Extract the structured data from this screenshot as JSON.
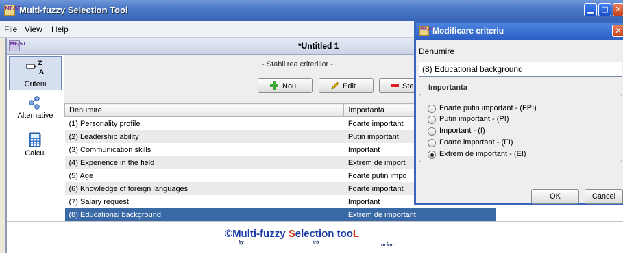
{
  "app": {
    "title": "Multi-fuzzy Selection Tool",
    "icon": "MF/ST"
  },
  "menu": [
    "File",
    "View",
    "Help"
  ],
  "document": {
    "title": "*Untitled 1"
  },
  "sidebar": [
    {
      "label": "Criterii",
      "icon": "criteria-icon"
    },
    {
      "label": "Alternative",
      "icon": "alternatives-icon"
    },
    {
      "label": "Calcul",
      "icon": "calculator-icon"
    }
  ],
  "criteria": {
    "heading": "- Stabilirea criteriilor -",
    "buttons": {
      "new": "Nou",
      "edit": "Edit",
      "delete": "Ster"
    },
    "columns": [
      "Denumire",
      "Importanta"
    ],
    "rows": [
      {
        "name": "(1) Personality profile",
        "importance": "Foarte important"
      },
      {
        "name": "(2) Leadership ability",
        "importance": "Putin important"
      },
      {
        "name": "(3) Communication skills",
        "importance": "Important"
      },
      {
        "name": "(4) Experience in the field",
        "importance": "Extrem de import"
      },
      {
        "name": "(5) Age",
        "importance": "Foarte putin impo"
      },
      {
        "name": "(6) Knowledge of foreign languages",
        "importance": "Foarte important"
      },
      {
        "name": "(7) Salary request",
        "importance": "Important"
      },
      {
        "name": "(8) Educational background",
        "importance": "Extrem de important"
      }
    ],
    "selected_index": 7
  },
  "footer": {
    "copyright": "©",
    "logo_a": "Multi-fuzzy ",
    "logo_s": "S",
    "logo_b": "election too",
    "logo_l": "L",
    "by": "by",
    "irb": "irb",
    "ucian": "ucian"
  },
  "dialog": {
    "title": "Modificare criteriu",
    "name_label": "Denumire",
    "name_value": "(8) Educational background",
    "group_label": "Importanta",
    "options": [
      "Foarte putin important - (FPI)",
      "Putin important - (PI)",
      "Important - (I)",
      "Foarte important - (FI)",
      "Extrem de important - (EI)"
    ],
    "selected_option": 4,
    "ok": "OK",
    "cancel": "Cancel"
  },
  "colors": {
    "title_bar": "#4c79c7",
    "selection": "#3a6aa6",
    "logo": "#1a3aa8"
  }
}
